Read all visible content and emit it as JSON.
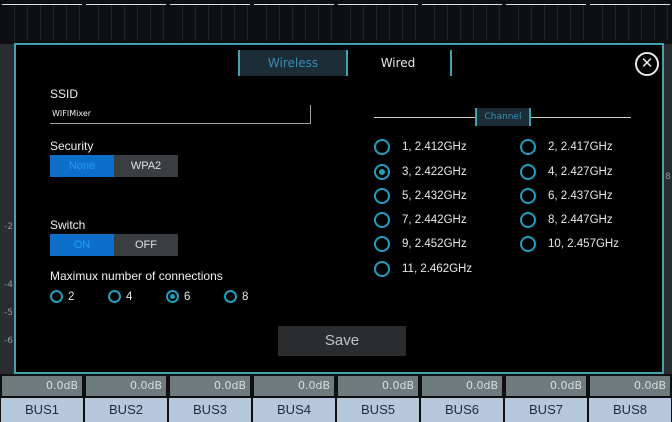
{
  "background": {
    "scale_labels": [
      "-2",
      "-4",
      "-5",
      "-6",
      "8"
    ],
    "values": [
      "0.0dB",
      "0.0dB",
      "0.0dB",
      "0.0dB",
      "0.0dB",
      "0.0dB",
      "0.0dB",
      "0.0dB"
    ],
    "buses": [
      "BUS1",
      "BUS2",
      "BUS3",
      "BUS4",
      "BUS5",
      "BUS6",
      "BUS7",
      "BUS8"
    ]
  },
  "dialog": {
    "tabs": {
      "wireless": "Wireless",
      "wired": "Wired"
    },
    "close_icon": "close-icon",
    "ssid": {
      "label": "SSID",
      "value": "WIFIMixer"
    },
    "security": {
      "label": "Security",
      "options": [
        "None",
        "WPA2"
      ],
      "selected": "None"
    },
    "switch": {
      "label": "Switch",
      "options": [
        "ON",
        "OFF"
      ],
      "selected": "ON"
    },
    "max_connections": {
      "label": "Maximux number of connections",
      "options": [
        "2",
        "4",
        "6",
        "8"
      ],
      "selected": "6"
    },
    "channel": {
      "label": "Channel",
      "options": [
        "1, 2.412GHz",
        "2, 2.417GHz",
        "3, 2.422GHz",
        "4, 2.427GHz",
        "5, 2.432GHz",
        "6, 2.437GHz",
        "7, 2.442GHz",
        "8, 2.447GHz",
        "9, 2.452GHz",
        "10, 2.457GHz",
        "11, 2.462GHz"
      ],
      "selected": "3, 2.422GHz"
    },
    "save_label": "Save",
    "colors": {
      "accent": "#3fa4b2",
      "selected_blue": "#0e6fc8",
      "radio": "#1e9fc1"
    }
  }
}
